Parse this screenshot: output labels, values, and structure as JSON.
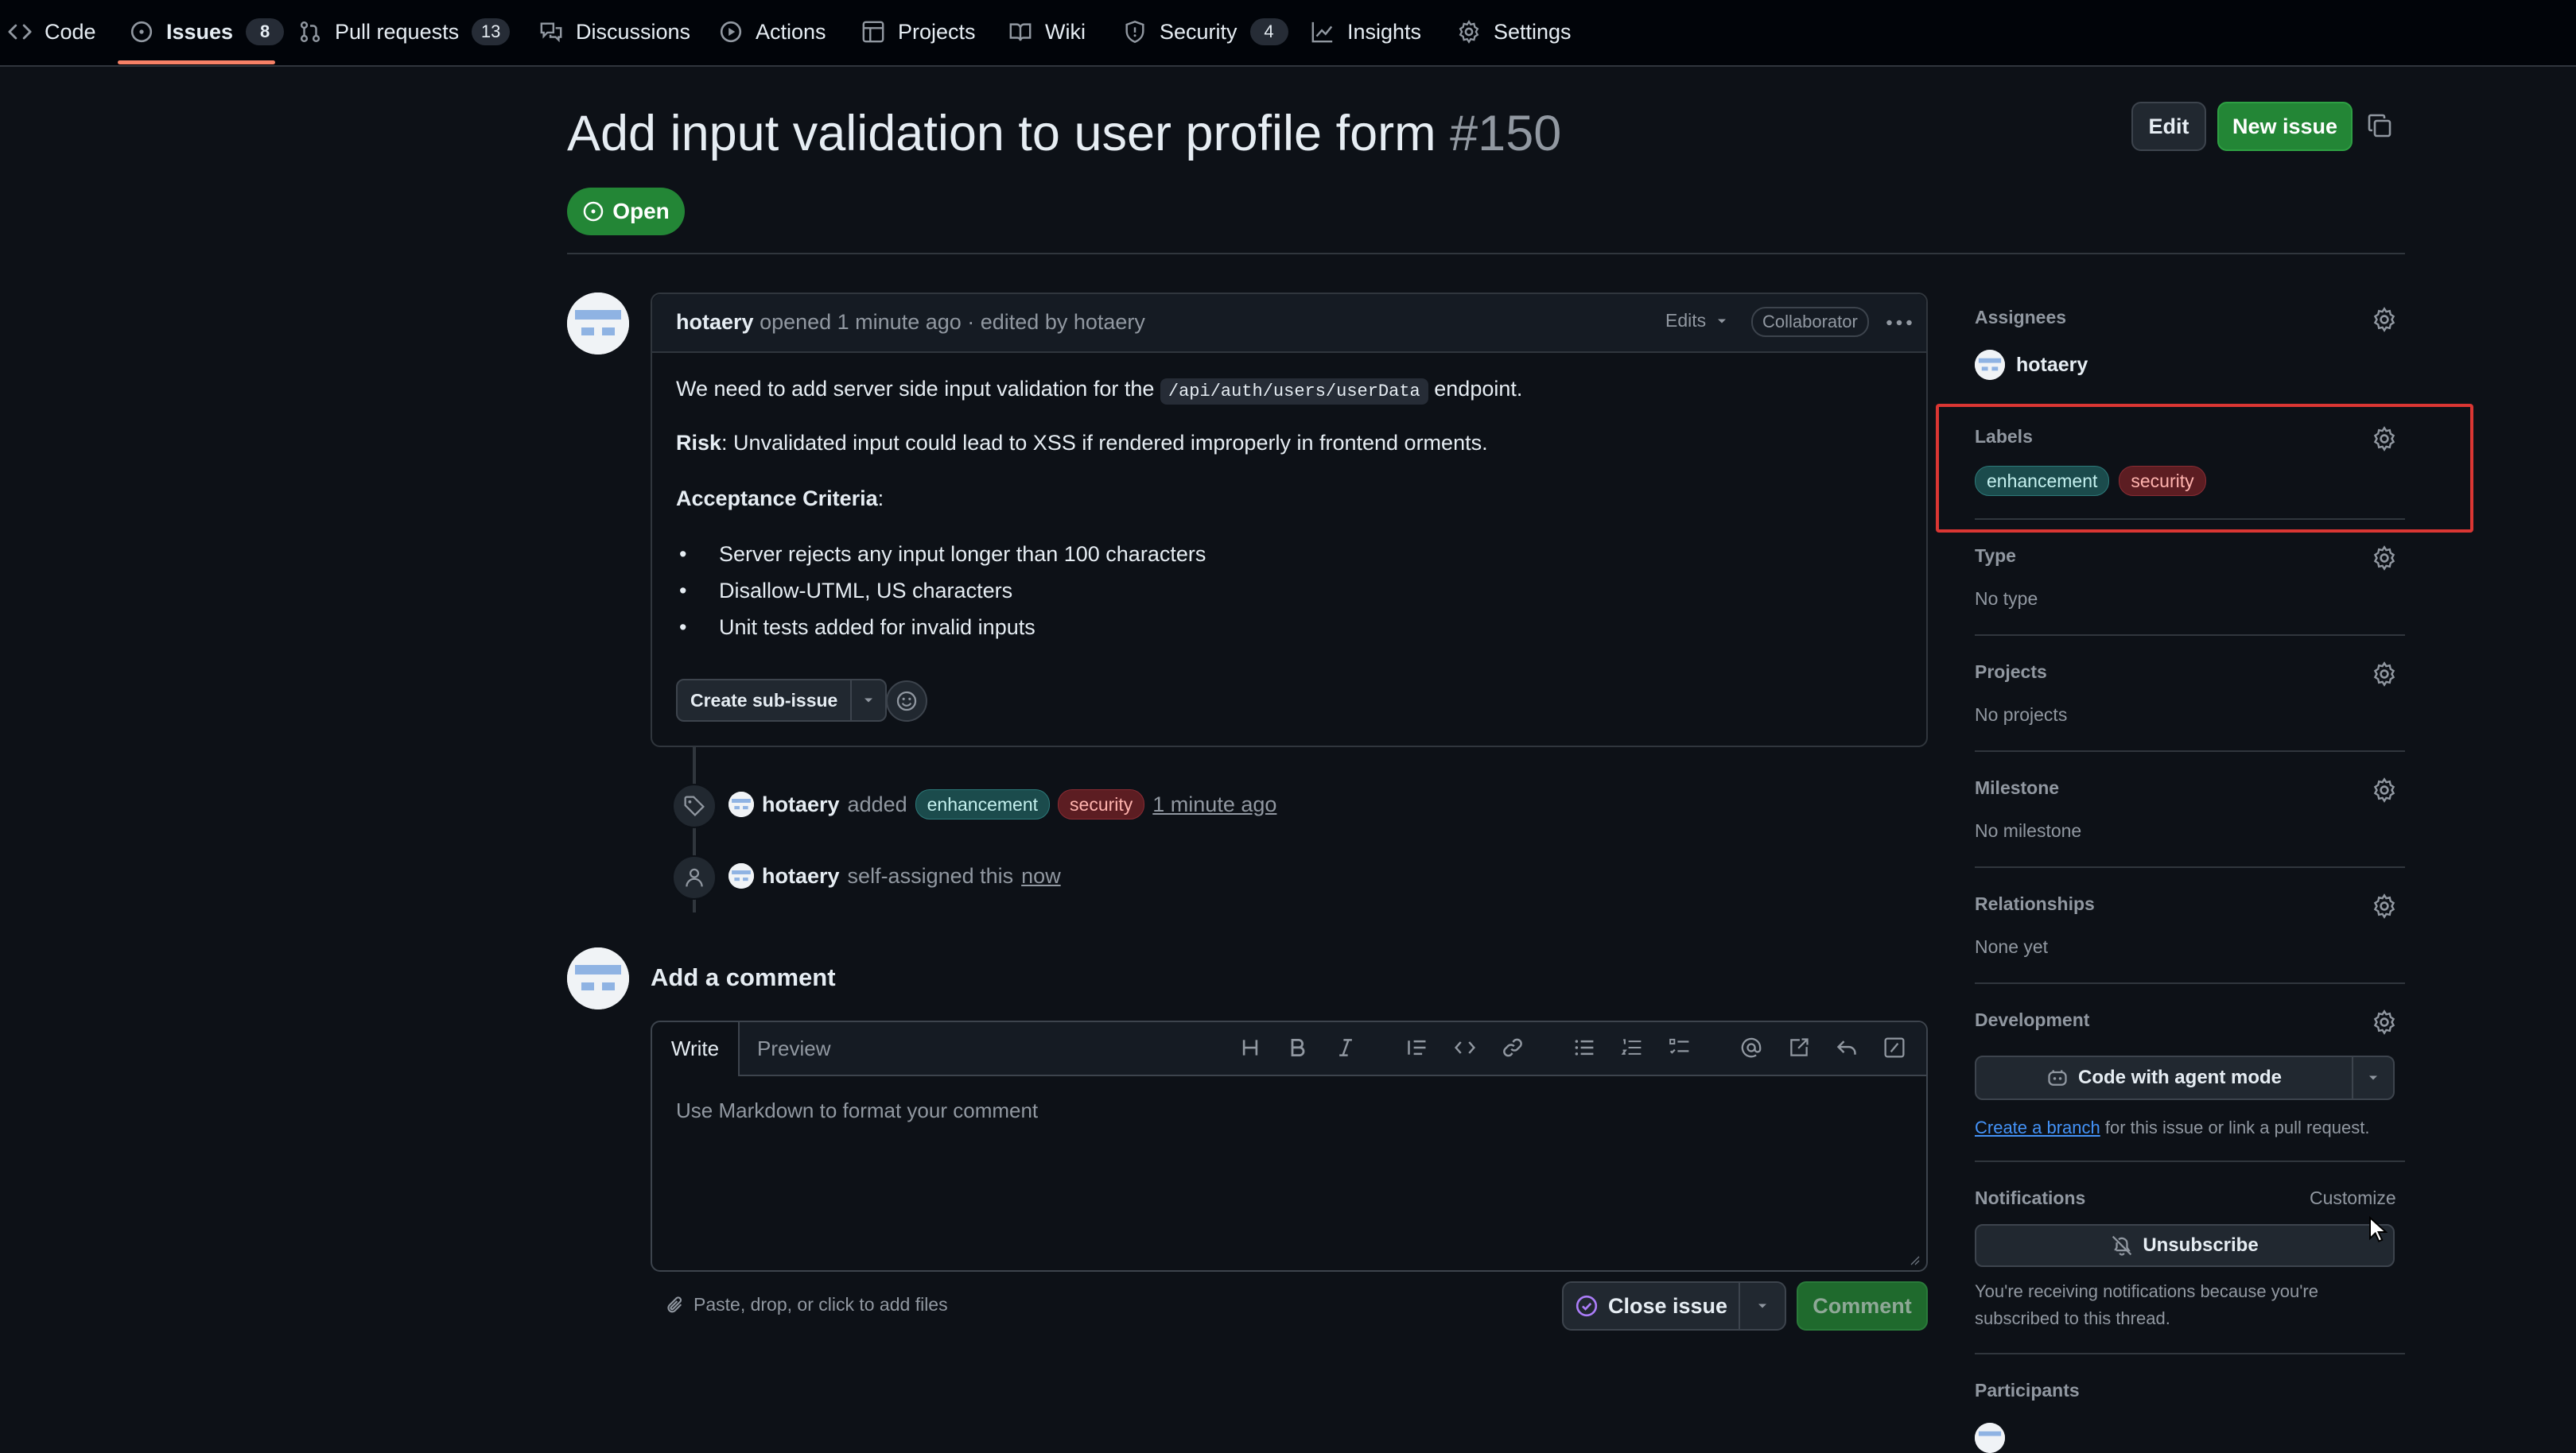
{
  "nav": {
    "tabs": [
      {
        "label": "Code"
      },
      {
        "label": "Issues",
        "count": "8"
      },
      {
        "label": "Pull requests",
        "count": "13"
      },
      {
        "label": "Discussions"
      },
      {
        "label": "Actions"
      },
      {
        "label": "Projects"
      },
      {
        "label": "Wiki"
      },
      {
        "label": "Security",
        "count": "4"
      },
      {
        "label": "Insights"
      },
      {
        "label": "Settings"
      }
    ]
  },
  "issue": {
    "title": "Add input validation to user profile form",
    "number": "#150",
    "state": "Open",
    "edit_label": "Edit",
    "new_issue_label": "New issue"
  },
  "comment": {
    "author": "hotaery",
    "meta": "opened 1 minute ago · edited by hotaery",
    "edits_label": "Edits",
    "role_badge": "Collaborator",
    "line1_before": "We need to add server side input validation for the",
    "line1_code": "/api/auth/users/userData",
    "line1_after": "endpoint.",
    "risk_label": "Risk",
    "risk_text": ": Unvalidated input could lead to XSS if rendered improperly in frontend orments.",
    "criteria_label": "Acceptance Criteria",
    "criteria_colon": ":",
    "bullets": [
      "Server rejects any input longer than 100 characters",
      "Disallow-UTML, US characters",
      "Unit tests added for invalid inputs"
    ],
    "create_subissue_label": "Create sub-issue"
  },
  "timeline": {
    "event1": {
      "author": "hotaery",
      "action": "added",
      "labels": [
        "enhancement",
        "security"
      ],
      "time": "1 minute ago"
    },
    "event2": {
      "author": "hotaery",
      "action": "self-assigned this",
      "time": "now"
    }
  },
  "add_comment": {
    "heading": "Add a comment",
    "tab_write": "Write",
    "tab_preview": "Preview",
    "placeholder": "Use Markdown to format your comment",
    "attach_hint": "Paste, drop, or click to add files",
    "close_issue_label": "Close issue",
    "comment_label": "Comment"
  },
  "sidebar": {
    "assignees": {
      "heading": "Assignees",
      "value": "hotaery"
    },
    "labels": {
      "heading": "Labels",
      "items": [
        "enhancement",
        "security"
      ]
    },
    "type": {
      "heading": "Type",
      "value": "No type"
    },
    "projects": {
      "heading": "Projects",
      "value": "No projects"
    },
    "milestone": {
      "heading": "Milestone",
      "value": "No milestone"
    },
    "relationships": {
      "heading": "Relationships",
      "value": "None yet"
    },
    "development": {
      "heading": "Development",
      "agent_button": "Code with agent mode",
      "branch_link": "Create a branch",
      "branch_text": "for this issue or link a pull request."
    },
    "notifications": {
      "heading": "Notifications",
      "customize": "Customize",
      "unsubscribe": "Unsubscribe",
      "reason_line1": "You're receiving notifications because you're",
      "reason_line2": "subscribed to this thread."
    },
    "participants": {
      "heading": "Participants"
    }
  },
  "colors": {
    "background": "#0d1117",
    "accent_green": "#238636",
    "highlight_red": "#da3633",
    "link_blue": "#4493f8"
  }
}
